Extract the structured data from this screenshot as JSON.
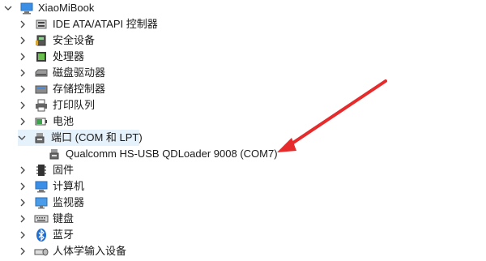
{
  "root": {
    "label": "XiaoMiBook",
    "icon": "computer-icon"
  },
  "items": [
    {
      "label": "IDE ATA/ATAPI 控制器",
      "icon": "ide-controller-icon",
      "expanded": false
    },
    {
      "label": "安全设备",
      "icon": "security-device-icon",
      "expanded": false
    },
    {
      "label": "处理器",
      "icon": "processor-icon",
      "expanded": false
    },
    {
      "label": "磁盘驱动器",
      "icon": "disk-drive-icon",
      "expanded": false
    },
    {
      "label": "存储控制器",
      "icon": "storage-controller-icon",
      "expanded": false
    },
    {
      "label": "打印队列",
      "icon": "printer-icon",
      "expanded": false
    },
    {
      "label": "电池",
      "icon": "battery-icon",
      "expanded": false
    },
    {
      "label": "端口 (COM 和 LPT)",
      "icon": "port-icon",
      "expanded": true
    },
    {
      "label": "固件",
      "icon": "firmware-icon",
      "expanded": false
    },
    {
      "label": "计算机",
      "icon": "computer-icon",
      "expanded": false
    },
    {
      "label": "监视器",
      "icon": "monitor-icon",
      "expanded": false
    },
    {
      "label": "键盘",
      "icon": "keyboard-icon",
      "expanded": false
    },
    {
      "label": "蓝牙",
      "icon": "bluetooth-icon",
      "expanded": false
    },
    {
      "label": "人体学输入设备",
      "icon": "hid-icon",
      "expanded": false
    }
  ],
  "port_child": {
    "label": "Qualcomm HS-USB QDLoader 9008 (COM7)",
    "icon": "port-icon"
  },
  "colors": {
    "arrow": "#e52b2b",
    "selection": "#e5f1fb"
  }
}
